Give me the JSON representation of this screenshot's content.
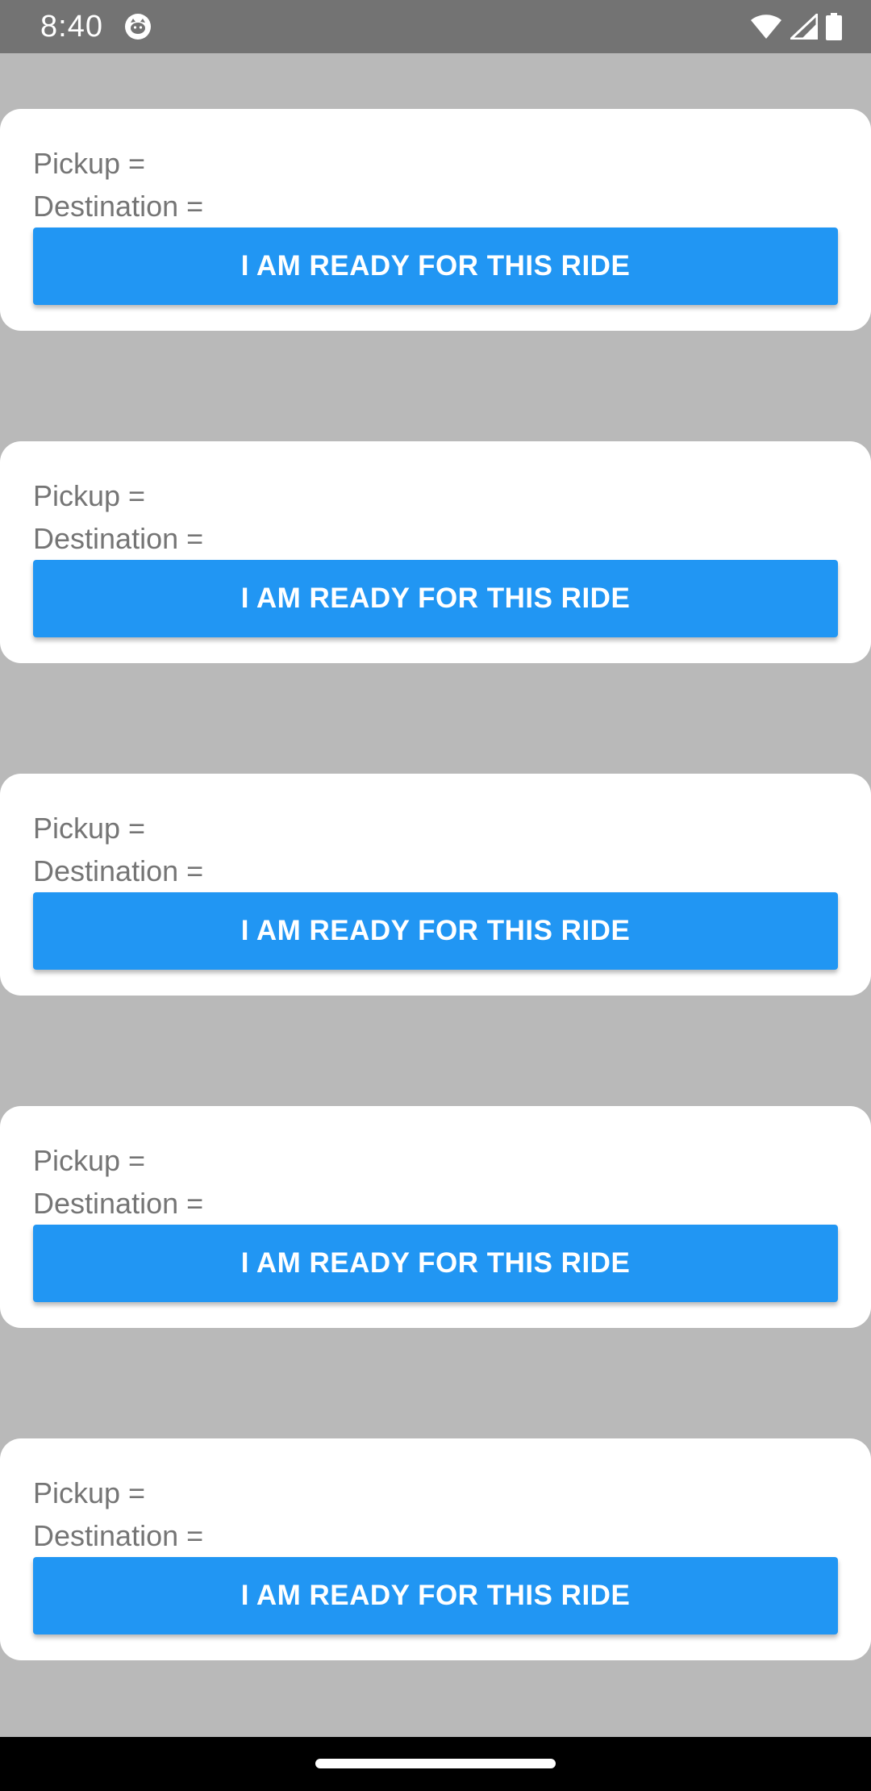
{
  "status_bar": {
    "time": "8:40",
    "icons": [
      "cat-notification-icon",
      "wifi-icon",
      "cellular-signal-icon",
      "battery-icon"
    ]
  },
  "rides": [
    {
      "pickup_label": "Pickup =",
      "destination_label": "Destination =",
      "button_label": "I AM READY FOR THIS RIDE"
    },
    {
      "pickup_label": "Pickup =",
      "destination_label": "Destination =",
      "button_label": "I AM READY FOR THIS RIDE"
    },
    {
      "pickup_label": "Pickup =",
      "destination_label": "Destination =",
      "button_label": "I AM READY FOR THIS RIDE"
    },
    {
      "pickup_label": "Pickup =",
      "destination_label": "Destination =",
      "button_label": "I AM READY FOR THIS RIDE"
    },
    {
      "pickup_label": "Pickup =",
      "destination_label": "Destination =",
      "button_label": "I AM READY FOR THIS RIDE"
    }
  ],
  "colors": {
    "accent": "#2196f3",
    "background": "#b9b9b9",
    "status_bar": "#737373",
    "label_text": "#757575"
  }
}
